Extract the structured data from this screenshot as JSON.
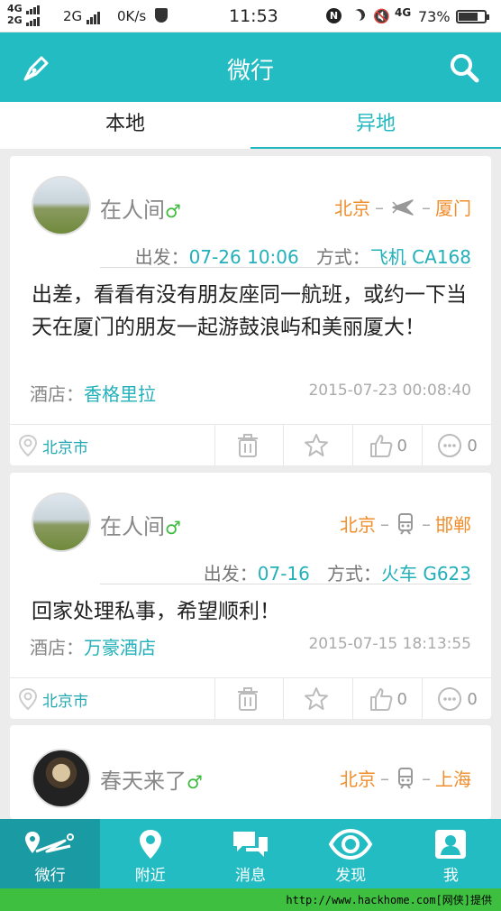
{
  "status_bar": {
    "net_top": "4G",
    "net_bottom": "2G",
    "net2": "2G",
    "speed": "0K/s",
    "time": "11:53",
    "n_badge": "N",
    "net4g": "4G",
    "battery_pct": "73%",
    "battery_level": 0.73
  },
  "appbar": {
    "title": "微行",
    "left_icon": "pen-icon",
    "right_icon": "search-icon"
  },
  "tabs": [
    {
      "label": "本地",
      "active": false
    },
    {
      "label": "异地",
      "active": true
    }
  ],
  "posts": [
    {
      "user": "在人间",
      "gender": "♂",
      "from": "北京",
      "to": "厦门",
      "transport_icon": "plane-icon",
      "depart_label": "出发：",
      "depart_time": "07-26 10:06",
      "mode_label": "方式：",
      "mode": "飞机 CA168",
      "content": "出差，看看有没有朋友座同一航班，或约一下当天在厦门的朋友一起游鼓浪屿和美丽厦大！",
      "hotel_label": "酒店：",
      "hotel": "香格里拉",
      "time": "2015-07-23 00:08:40",
      "location": "北京市",
      "likes": "0",
      "comments": "0"
    },
    {
      "user": "在人间",
      "gender": "♂",
      "from": "北京",
      "to": "邯郸",
      "transport_icon": "train-icon",
      "depart_label": "出发：",
      "depart_time": "07-16",
      "mode_label": "方式：",
      "mode": "火车 G623",
      "content": "回家处理私事，希望顺利！",
      "hotel_label": "酒店：",
      "hotel": "万豪酒店",
      "time": "2015-07-15 18:13:55",
      "location": "北京市",
      "likes": "0",
      "comments": "0"
    },
    {
      "user": "春天来了",
      "gender": "♂",
      "from": "北京",
      "to": "上海",
      "transport_icon": "train-icon"
    }
  ],
  "bottom_nav": [
    {
      "label": "微行",
      "icon": "route-icon",
      "active": true
    },
    {
      "label": "附近",
      "icon": "map-pin-icon",
      "active": false
    },
    {
      "label": "消息",
      "icon": "chat-bubbles-icon",
      "active": false
    },
    {
      "label": "发现",
      "icon": "eye-icon",
      "active": false
    },
    {
      "label": "我",
      "icon": "user-icon",
      "active": false
    }
  ],
  "footer": {
    "text": "http://www.hackhome.com[网侠]提供"
  }
}
